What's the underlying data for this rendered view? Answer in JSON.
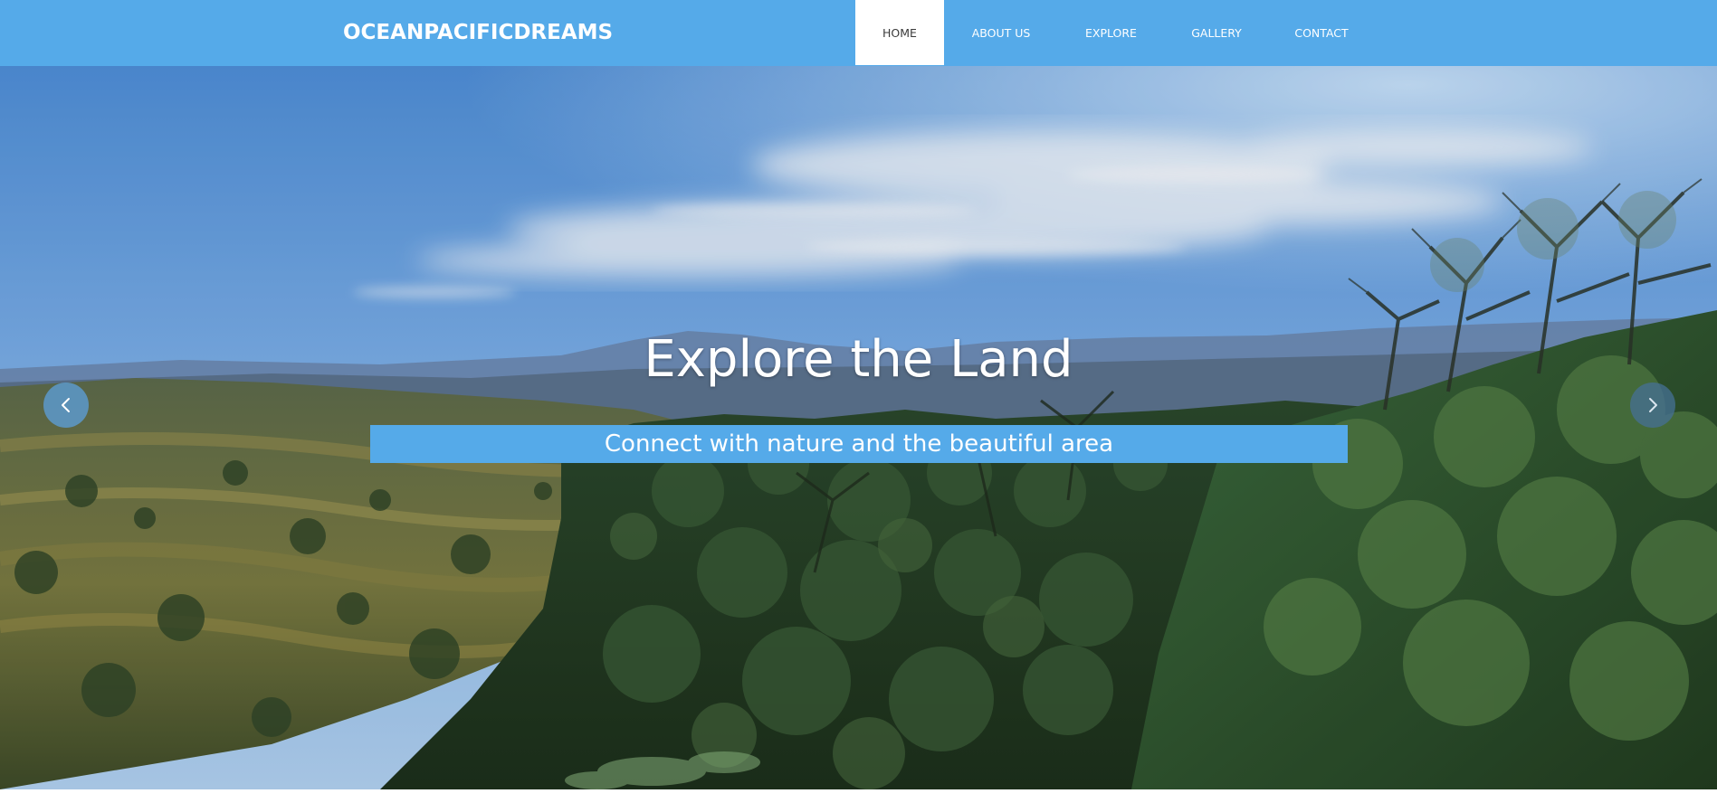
{
  "header": {
    "brand": "OCEANPACIFICDREAMS",
    "nav": [
      {
        "label": "HOME",
        "active": true
      },
      {
        "label": "ABOUT US",
        "active": false
      },
      {
        "label": "EXPLORE",
        "active": false
      },
      {
        "label": "GALLERY",
        "active": false
      },
      {
        "label": "CONTACT",
        "active": false
      }
    ],
    "accent_color": "#55aae9"
  },
  "hero": {
    "title": "Explore the Land",
    "subtitle": "Connect with nature and the beautiful area",
    "background_image": "landscape-photo",
    "prev_icon": "chevron-left-icon",
    "next_icon": "chevron-right-icon"
  }
}
